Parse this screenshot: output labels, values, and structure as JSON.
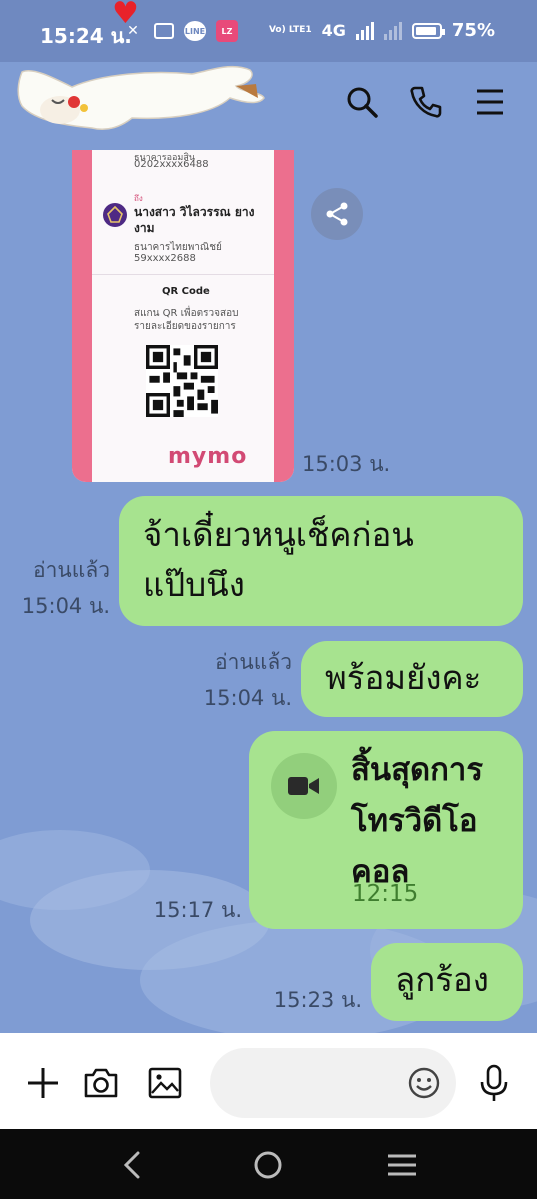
{
  "status_bar": {
    "time": "15:24 น.",
    "network": "4G",
    "volte": "Vo) LTE1",
    "battery": "75%",
    "line_badge": "LINE",
    "lz_badge": "LZ"
  },
  "header": {
    "icons": [
      "search-icon",
      "phone-icon",
      "menu-icon"
    ]
  },
  "slip_image": {
    "bank_top": "ธนาคารออมสิน",
    "account_top": "0202xxxx6488",
    "to_label": "ถึง",
    "recipient_name": "นางสาว วิไลวรรณ ยาง งาม",
    "recipient_bank": "ธนาคารไทยพาณิชย์",
    "recipient_account": "59xxxx2688",
    "qr_title": "QR Code",
    "qr_desc_1": "สแกน QR เพื่อตรวจสอบ",
    "qr_desc_2": "รายละเอียดของรายการ",
    "brand": "mymo"
  },
  "messages": [
    {
      "type": "image",
      "side": "incoming",
      "time": "15:03 น."
    },
    {
      "type": "text",
      "side": "outgoing",
      "read": "อ่านแล้ว",
      "time": "15:04 น.",
      "line1": "จ้าเดี๋ยวหนูเช็คก่อน",
      "line2": "แป๊บนึง"
    },
    {
      "type": "text",
      "side": "outgoing",
      "read": "อ่านแล้ว",
      "time": "15:04 น.",
      "text": "พร้อมยังคะ"
    },
    {
      "type": "call",
      "side": "outgoing",
      "time": "15:17 น.",
      "line1": "สิ้นสุดการ",
      "line2": "โทรวิดีโอ",
      "line3": "คอล",
      "duration": "12:15"
    },
    {
      "type": "text",
      "side": "outgoing",
      "time": "15:23 น.",
      "text": "ลูกร้อง"
    }
  ],
  "input_bar": {
    "icons": [
      "plus-icon",
      "camera-icon",
      "image-icon",
      "emoji-icon",
      "mic-icon"
    ],
    "placeholder": ""
  },
  "nav_bar": {
    "icons": [
      "back-icon",
      "home-icon",
      "recents-icon"
    ]
  },
  "colors": {
    "chat_bg": "#7f9cd3",
    "bubble_green": "#a7e38f",
    "status_bar": "#6f89c0"
  }
}
